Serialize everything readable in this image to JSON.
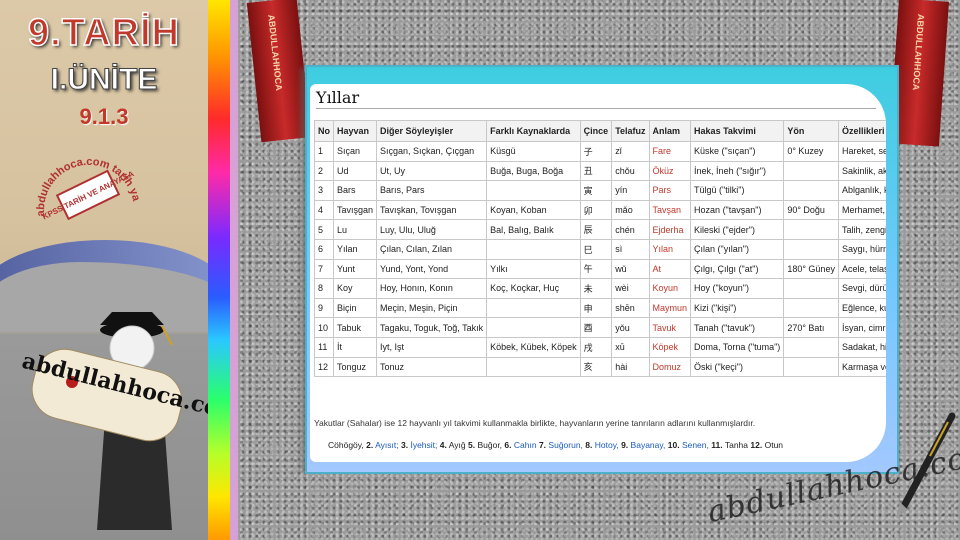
{
  "sidebar": {
    "title": "9.TARİH",
    "unit": "I.ÜNİTE",
    "section": "9.1.3",
    "stamp_ring": "abdullahhoca.com tarih yazıyor",
    "stamp_center": "KPSS TARİH VE ANAYASA",
    "scroll_text": "abdullahhoca.com"
  },
  "ribbons": {
    "left": "ABDULLAHHOCA",
    "right": "ABDULLAHHOCA"
  },
  "document": {
    "title": "Yıllar",
    "headers": [
      "No",
      "Hayvan",
      "Diğer Söyleyişler",
      "Farklı Kaynaklarda",
      "Çince",
      "Telafuz",
      "Anlam",
      "Hakas Takvimi",
      "Yön",
      "Özellikleri"
    ],
    "rows": [
      [
        "1",
        "Sıçan",
        "Sıçgan, Sıçkan, Çıçgan",
        "Küsgü",
        "子",
        "zǐ",
        "Fare",
        "Küske (\"sıçan\")",
        "0° Kuzey",
        "Hareket, sezgi."
      ],
      [
        "2",
        "Ud",
        "Ut, Uy",
        "Buğa, Buga, Boğa",
        "丑",
        "chǒu",
        "Öküz",
        "İnek, İneh (\"sığır\")",
        "",
        "Sakinlik, akıl, bilinç"
      ],
      [
        "3",
        "Bars",
        "Barıs, Pars",
        "",
        "寅",
        "yín",
        "Pars",
        "Tülgü (\"tilki\")",
        "",
        "Ablganlık, kavga."
      ],
      [
        "4",
        "Tavışgan",
        "Tavışkan, Tovışgan",
        "Koyan, Koban",
        "卯",
        "mǎo",
        "Tavşan",
        "Hozan (\"tavşan\")",
        "90° Doğu",
        "Merhamet, korkaklık."
      ],
      [
        "5",
        "Lu",
        "Luy, Ulu, Uluğ",
        "Bal, Balıg, Balık",
        "辰",
        "chén",
        "Ejderha",
        "Kileski (\"ejder\")",
        "",
        "Talih, zenginlik."
      ],
      [
        "6",
        "Yılan",
        "Çılan, Cılan, Zılan",
        "",
        "巳",
        "sì",
        "Yılan",
        "Çılan (\"yılan\")",
        "",
        "Saygı, hürmet, korku."
      ],
      [
        "7",
        "Yunt",
        "Yund, Yont, Yond",
        "Yılkı",
        "午",
        "wǔ",
        "At",
        "Çılgı, Çılgı (\"at\")",
        "180° Güney",
        "Acele, telaş, sürat."
      ],
      [
        "8",
        "Koy",
        "Hoy, Honın, Konın",
        "Koç, Koçkar, Huç",
        "未",
        "wèi",
        "Koyun",
        "Hoy (\"koyun\")",
        "",
        "Sevgi, dürüstlük,çokluk."
      ],
      [
        "9",
        "Biçin",
        "Meçin, Meşin, Piçin",
        "",
        "申",
        "shēn",
        "Maymun",
        "Kizi (\"kişi\")",
        "",
        "Eğlence, kurnazlık."
      ],
      [
        "10",
        "Tabuk",
        "Tagaku, Toguk, Toğ, Takık",
        "",
        "酉",
        "yǒu",
        "Tavuk",
        "Tanah (\"tavuk\")",
        "270° Batı",
        "İsyan, cimrilik."
      ],
      [
        "11",
        "İt",
        "Iyt, Işt",
        "Köbek, Kübek, Köpek",
        "戌",
        "xū",
        "Köpek",
        "Doma, Torna (\"tuma\")",
        "",
        "Sadakat, hissiyat."
      ],
      [
        "12",
        "Tonguz",
        "Tonuz",
        "",
        "亥",
        "hài",
        "Domuz",
        "Öski (\"keçi\")",
        "",
        "Karmaşa ve sükunet."
      ]
    ],
    "note": "Yakutlar (Sahalar) ise 12 hayvanlı yıl takvimi kullanmakla birlikte, hayvanların yerine tanrıların adlarını kullanmışlardır.",
    "sahalar_items": [
      "Cöhögöy,",
      "2.",
      "Ayısıt;",
      "3.",
      "İyehsit;",
      "4.",
      "Ayığ",
      "5.",
      "Buğor,",
      "6.",
      "Cahın",
      "7.",
      "Suğorun,",
      "8.",
      "Hotoy,",
      "9.",
      "Bayanay,",
      "10.",
      "Senen,",
      "11.",
      "Tanha",
      "12.",
      "Otun"
    ]
  },
  "watermark": "abdullahhoca.com",
  "colors": {
    "accent_red": "#c0392b",
    "frame": "#3ecde0",
    "link_blue": "#1a5bbf"
  }
}
